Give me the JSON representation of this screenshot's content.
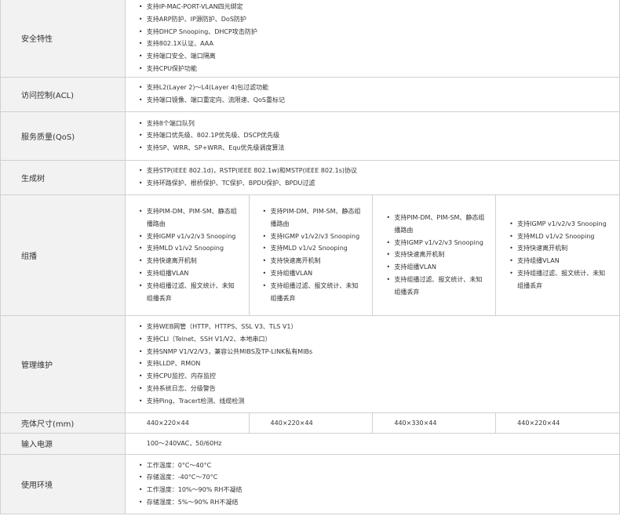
{
  "rows": [
    {
      "id": "security",
      "label": "安全特性",
      "items": [
        "支持IP-MAC-PORT-VLAN四元绑定",
        "支持ARP防护、IP源防护、DoS防护",
        "支持DHCP Snooping、DHCP攻击防护",
        "支持802.1X认证、AAA",
        "支持端口安全、端口隔离",
        "支持CPU保护功能"
      ]
    },
    {
      "id": "acl",
      "label": "访问控制(ACL)",
      "items": [
        "支持L2(Layer 2)～L4(Layer 4)包过滤功能",
        "支持端口镜像、端口重定向、流限速、QoS重标记"
      ]
    },
    {
      "id": "qos",
      "label": "服务质量(QoS)",
      "items": [
        "支持8个端口队列",
        "支持端口优先级、802.1P优先级、DSCP优先级",
        "支持SP、WRR、SP+WRR、Equ优先级调度算法"
      ]
    },
    {
      "id": "stp",
      "label": "生成树",
      "items": [
        "支持STP(IEEE 802.1d)，RSTP(IEEE 802.1w)和MSTP(IEEE 802.1s)协议",
        "支持环路保护、根桥保护、TC保护、BPDU保护、BPDU过滤"
      ]
    }
  ],
  "multicast": {
    "label": "组播",
    "columns": [
      [
        "支持PIM-DM、PIM-SM、静态组播路由",
        "支持IGMP v1/v2/v3 Snooping",
        "支持MLD v1/v2 Snooping",
        "支持快速离开机制",
        "支持组播VLAN",
        "支持组播过滤、报文统计、未知组播丢弃"
      ],
      [
        "支持PIM-DM、PIM-SM、静态组播路由",
        "支持IGMP v1/v2/v3 Snooping",
        "支持MLD v1/v2 Snooping",
        "支持快速离开机制",
        "支持组播VLAN",
        "支持组播过滤、报文统计、未知组播丢弃"
      ],
      [
        "支持PIM-DM、PIM-SM、静态组播路由",
        "支持IGMP v1/v2/v3 Snooping",
        "支持快速离开机制",
        "支持组播VLAN",
        "支持组播过滤、报文统计、未知组播丢弃"
      ],
      [
        "支持IGMP v1/v2/v3 Snooping",
        "支持MLD v1/v2 Snooping",
        "支持快速离开机制",
        "支持组播VLAN",
        "支持组播过滤、报文统计、未知组播丢弃"
      ]
    ]
  },
  "management": {
    "label": "管理维护",
    "items": [
      "支持WEB网管（HTTP、HTTPS、SSL V3、TLS V1）",
      "支持CLI（Telnet、SSH V1/V2、本地串口）",
      "支持SNMP V1/V2/V3，兼容公共MIBS及TP-LINK私有MIBs",
      "支持LLDP、RMON",
      "支持CPU监控、内存监控",
      "支持系统日志、分级警告",
      "支持Ping、Tracert检测、线缆检测"
    ]
  },
  "dimensions": {
    "label": "壳体尺寸(mm)",
    "values": [
      "440×220×44",
      "440×220×44",
      "440×330×44",
      "440×220×44"
    ]
  },
  "power": {
    "label": "输入电源",
    "value": "100～240VAC，50/60Hz"
  },
  "environment": {
    "label": "使用环境",
    "items": [
      "工作温度：0°C～40°C",
      "存储温度：-40°C～70°C",
      "工作湿度：10%～90% RH不凝结",
      "存储湿度：5%～90% RH不凝结"
    ]
  }
}
